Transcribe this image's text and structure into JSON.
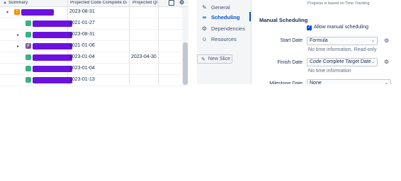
{
  "grid": {
    "headers": {
      "summary": "Summary",
      "projected_code_complete": "Projected Code Complete Da",
      "projected_qa": "Projected Q/"
    },
    "rows": [
      {
        "indent": 0,
        "expanded": true,
        "type": "epic",
        "type_color": "#ff8b00",
        "type_glyph": "!",
        "redacted_width": 46,
        "code_complete": "2023-08-31",
        "qa": ""
      },
      {
        "indent": 1,
        "expanded": null,
        "type": "story",
        "type_color": "#36b37e",
        "type_glyph": "■",
        "redacted_width": 56,
        "code_complete": "2021-01-27",
        "qa": ""
      },
      {
        "indent": 1,
        "expanded": false,
        "type": "story",
        "type_color": "#36b37e",
        "type_glyph": "■",
        "redacted_width": 56,
        "code_complete": "2023-08-31",
        "qa": ""
      },
      {
        "indent": 1,
        "expanded": false,
        "type": "subtask",
        "type_color": "#6554c0",
        "type_glyph": "⚡",
        "redacted_width": 56,
        "code_complete": "2021-01-06",
        "qa": ""
      },
      {
        "indent": 1,
        "expanded": null,
        "type": "story",
        "type_color": "#36b37e",
        "type_glyph": "■",
        "redacted_width": 56,
        "code_complete": "2023-01-04",
        "qa": "2023-04-30"
      },
      {
        "indent": 1,
        "expanded": null,
        "type": "story",
        "type_color": "#36b37e",
        "type_glyph": "■",
        "redacted_width": 56,
        "code_complete": "2023-01-04",
        "qa": ""
      },
      {
        "indent": 1,
        "expanded": null,
        "type": "story",
        "type_color": "#36b37e",
        "type_glyph": "■",
        "redacted_width": 56,
        "code_complete": "2023-01-13",
        "qa": ""
      }
    ]
  },
  "nav": {
    "items": [
      {
        "label": "General",
        "icon": "pencil-icon",
        "glyph": "✎",
        "active": false
      },
      {
        "label": "Scheduling",
        "icon": "link-icon",
        "glyph": "⛓",
        "active": true
      },
      {
        "label": "Dependencies",
        "icon": "dependencies-icon",
        "glyph": "⚙",
        "active": false
      },
      {
        "label": "Resources",
        "icon": "people-icon",
        "glyph": "☺",
        "active": false
      }
    ],
    "new_slice": "New Slice"
  },
  "settings": {
    "progress_note": "Progress is based on Time Tracking",
    "section_title": "Manual Scheduling",
    "allow_manual_label": "Allow manual scheduling",
    "allow_manual_checked": true,
    "start_date": {
      "label": "Start Date",
      "value": "Formula",
      "hint": "No time information, Read-only"
    },
    "finish_date": {
      "label": "Finish Date",
      "value": "Code Complete Target Date",
      "hint": "No time information"
    },
    "milestone_date": {
      "label": "Milestone Date",
      "value": "None"
    }
  },
  "colors": {
    "accent": "#0052cc",
    "redaction": "#6b12e0"
  }
}
